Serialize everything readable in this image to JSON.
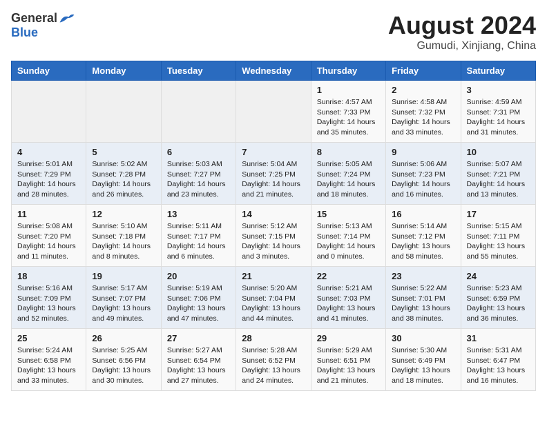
{
  "header": {
    "logo_general": "General",
    "logo_blue": "Blue",
    "month_year": "August 2024",
    "location": "Gumudi, Xinjiang, China"
  },
  "weekdays": [
    "Sunday",
    "Monday",
    "Tuesday",
    "Wednesday",
    "Thursday",
    "Friday",
    "Saturday"
  ],
  "weeks": [
    [
      {
        "day": "",
        "empty": true
      },
      {
        "day": "",
        "empty": true
      },
      {
        "day": "",
        "empty": true
      },
      {
        "day": "",
        "empty": true
      },
      {
        "day": "1",
        "sunrise": "4:57 AM",
        "sunset": "7:33 PM",
        "daylight": "14 hours and 35 minutes."
      },
      {
        "day": "2",
        "sunrise": "4:58 AM",
        "sunset": "7:32 PM",
        "daylight": "14 hours and 33 minutes."
      },
      {
        "day": "3",
        "sunrise": "4:59 AM",
        "sunset": "7:31 PM",
        "daylight": "14 hours and 31 minutes."
      }
    ],
    [
      {
        "day": "4",
        "sunrise": "5:01 AM",
        "sunset": "7:29 PM",
        "daylight": "14 hours and 28 minutes."
      },
      {
        "day": "5",
        "sunrise": "5:02 AM",
        "sunset": "7:28 PM",
        "daylight": "14 hours and 26 minutes."
      },
      {
        "day": "6",
        "sunrise": "5:03 AM",
        "sunset": "7:27 PM",
        "daylight": "14 hours and 23 minutes."
      },
      {
        "day": "7",
        "sunrise": "5:04 AM",
        "sunset": "7:25 PM",
        "daylight": "14 hours and 21 minutes."
      },
      {
        "day": "8",
        "sunrise": "5:05 AM",
        "sunset": "7:24 PM",
        "daylight": "14 hours and 18 minutes."
      },
      {
        "day": "9",
        "sunrise": "5:06 AM",
        "sunset": "7:23 PM",
        "daylight": "14 hours and 16 minutes."
      },
      {
        "day": "10",
        "sunrise": "5:07 AM",
        "sunset": "7:21 PM",
        "daylight": "14 hours and 13 minutes."
      }
    ],
    [
      {
        "day": "11",
        "sunrise": "5:08 AM",
        "sunset": "7:20 PM",
        "daylight": "14 hours and 11 minutes."
      },
      {
        "day": "12",
        "sunrise": "5:10 AM",
        "sunset": "7:18 PM",
        "daylight": "14 hours and 8 minutes."
      },
      {
        "day": "13",
        "sunrise": "5:11 AM",
        "sunset": "7:17 PM",
        "daylight": "14 hours and 6 minutes."
      },
      {
        "day": "14",
        "sunrise": "5:12 AM",
        "sunset": "7:15 PM",
        "daylight": "14 hours and 3 minutes."
      },
      {
        "day": "15",
        "sunrise": "5:13 AM",
        "sunset": "7:14 PM",
        "daylight": "14 hours and 0 minutes."
      },
      {
        "day": "16",
        "sunrise": "5:14 AM",
        "sunset": "7:12 PM",
        "daylight": "13 hours and 58 minutes."
      },
      {
        "day": "17",
        "sunrise": "5:15 AM",
        "sunset": "7:11 PM",
        "daylight": "13 hours and 55 minutes."
      }
    ],
    [
      {
        "day": "18",
        "sunrise": "5:16 AM",
        "sunset": "7:09 PM",
        "daylight": "13 hours and 52 minutes."
      },
      {
        "day": "19",
        "sunrise": "5:17 AM",
        "sunset": "7:07 PM",
        "daylight": "13 hours and 49 minutes."
      },
      {
        "day": "20",
        "sunrise": "5:19 AM",
        "sunset": "7:06 PM",
        "daylight": "13 hours and 47 minutes."
      },
      {
        "day": "21",
        "sunrise": "5:20 AM",
        "sunset": "7:04 PM",
        "daylight": "13 hours and 44 minutes."
      },
      {
        "day": "22",
        "sunrise": "5:21 AM",
        "sunset": "7:03 PM",
        "daylight": "13 hours and 41 minutes."
      },
      {
        "day": "23",
        "sunrise": "5:22 AM",
        "sunset": "7:01 PM",
        "daylight": "13 hours and 38 minutes."
      },
      {
        "day": "24",
        "sunrise": "5:23 AM",
        "sunset": "6:59 PM",
        "daylight": "13 hours and 36 minutes."
      }
    ],
    [
      {
        "day": "25",
        "sunrise": "5:24 AM",
        "sunset": "6:58 PM",
        "daylight": "13 hours and 33 minutes."
      },
      {
        "day": "26",
        "sunrise": "5:25 AM",
        "sunset": "6:56 PM",
        "daylight": "13 hours and 30 minutes."
      },
      {
        "day": "27",
        "sunrise": "5:27 AM",
        "sunset": "6:54 PM",
        "daylight": "13 hours and 27 minutes."
      },
      {
        "day": "28",
        "sunrise": "5:28 AM",
        "sunset": "6:52 PM",
        "daylight": "13 hours and 24 minutes."
      },
      {
        "day": "29",
        "sunrise": "5:29 AM",
        "sunset": "6:51 PM",
        "daylight": "13 hours and 21 minutes."
      },
      {
        "day": "30",
        "sunrise": "5:30 AM",
        "sunset": "6:49 PM",
        "daylight": "13 hours and 18 minutes."
      },
      {
        "day": "31",
        "sunrise": "5:31 AM",
        "sunset": "6:47 PM",
        "daylight": "13 hours and 16 minutes."
      }
    ]
  ],
  "labels": {
    "sunrise_label": "Sunrise:",
    "sunset_label": "Sunset:",
    "daylight_label": "Daylight:"
  }
}
